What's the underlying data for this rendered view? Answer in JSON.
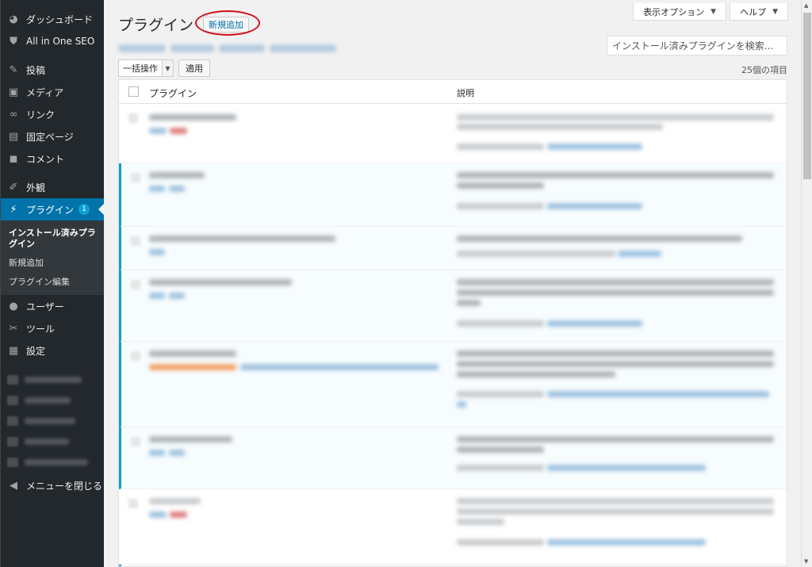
{
  "sidebar": {
    "items": [
      {
        "icon": "dashboard-icon",
        "glyph": "◕",
        "label": "ダッシュボード"
      },
      {
        "icon": "shield-icon",
        "glyph": "⛊",
        "label": "All in One SEO"
      },
      {
        "icon": "pin-icon",
        "glyph": "✎",
        "label": "投稿"
      },
      {
        "icon": "media-icon",
        "glyph": "▣",
        "label": "メディア"
      },
      {
        "icon": "link-icon",
        "glyph": "∞",
        "label": "リンク"
      },
      {
        "icon": "page-icon",
        "glyph": "▤",
        "label": "固定ページ"
      },
      {
        "icon": "comment-icon",
        "glyph": "◼",
        "label": "コメント"
      },
      {
        "icon": "appearance-icon",
        "glyph": "✐",
        "label": "外観"
      },
      {
        "icon": "plugin-icon",
        "glyph": "⚡",
        "label": "プラグイン",
        "badge": "1"
      },
      {
        "icon": "user-icon",
        "glyph": "●",
        "label": "ユーザー"
      },
      {
        "icon": "wrench-icon",
        "glyph": "✂",
        "label": "ツール"
      },
      {
        "icon": "settings-icon",
        "glyph": "▦",
        "label": "設定"
      }
    ],
    "submenu": {
      "installed": "インストール済みプラグイン",
      "add_new": "新規追加",
      "editor": "プラグイン編集"
    },
    "collapse": {
      "icon": "collapse-icon",
      "glyph": "◀",
      "label": "メニューを閉じる"
    }
  },
  "header": {
    "screen_options": "表示オプション",
    "help": "ヘルプ",
    "title": "プラグイン",
    "add_new": "新規追加"
  },
  "search": {
    "placeholder": "インストール済みプラグインを検索..."
  },
  "bulk": {
    "select": "一括操作",
    "apply": "適用"
  },
  "items_count": "25個の項目",
  "table": {
    "col_plugin": "プラグイン",
    "col_description": "説明"
  },
  "colors": {
    "accent": "#0073aa",
    "sidebar_bg": "#23282d",
    "active_border": "#00a0d2",
    "highlight_circle": "#d0101a"
  }
}
